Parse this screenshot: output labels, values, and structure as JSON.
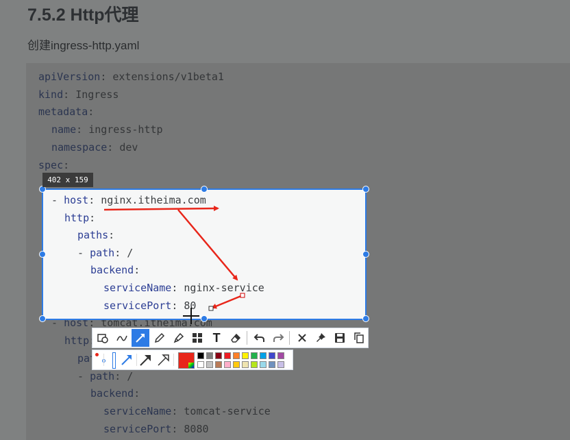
{
  "doc": {
    "heading": "7.5.2 Http代理",
    "subtext": "创建ingress-http.yaml"
  },
  "code": {
    "dim_top": [
      {
        "key": "apiVersion",
        "value": "extensions/v1beta1"
      },
      {
        "key": "kind",
        "value": "Ingress"
      },
      {
        "key": "metadata",
        "value": ""
      },
      {
        "key": "name",
        "value": "ingress-http"
      },
      {
        "key": "namespace",
        "value": "dev"
      },
      {
        "key": "spec",
        "value": ""
      }
    ],
    "selected": [
      {
        "prefix": "- ",
        "key": "host",
        "value": "nginx.itheima.com"
      },
      {
        "prefix": "",
        "key": "http",
        "value": ""
      },
      {
        "prefix": "",
        "key": "paths",
        "value": ""
      },
      {
        "prefix": "- ",
        "key": "path",
        "value": "/"
      },
      {
        "prefix": "",
        "key": "backend",
        "value": ""
      },
      {
        "prefix": "",
        "key": "serviceName",
        "value": "nginx-service"
      },
      {
        "prefix": "",
        "key": "servicePort",
        "value": "80"
      }
    ],
    "dim_bottom": [
      {
        "prefix": "- ",
        "key": "host",
        "value": "tomcat.itheima.com"
      },
      {
        "prefix": "",
        "key": "http",
        "value": ""
      },
      {
        "prefix": "",
        "key": "paths",
        "value": ""
      },
      {
        "prefix": "- ",
        "key": "path",
        "value": "/"
      },
      {
        "prefix": "",
        "key": "backend",
        "value": ""
      },
      {
        "prefix": "",
        "key": "serviceName",
        "value": "tomcat-service"
      },
      {
        "prefix": "",
        "key": "servicePort",
        "value": "8080"
      }
    ]
  },
  "capture": {
    "size_label": "402 x 159",
    "accent": "#2d7be5",
    "annotation_color": "#e8261a"
  },
  "toolbar": {
    "tools": [
      "rectangle-ellipse-tool-icon",
      "curve-tool-icon",
      "arrow-tool-icon",
      "pencil-tool-icon",
      "highlighter-tool-icon",
      "mosaic-tool-icon",
      "text-tool-icon",
      "eraser-tool-icon",
      "undo-icon",
      "redo-icon",
      "close-icon",
      "pin-icon",
      "save-icon",
      "copy-icon"
    ],
    "active_tool": "arrow-tool-icon",
    "text_tool_glyph": "T"
  },
  "palette": {
    "current": "#e8261a",
    "colors_row1": [
      "#000000",
      "#7f7f7f",
      "#880015",
      "#ed1c24",
      "#ff7f27",
      "#fff200",
      "#22b14c",
      "#00a2e8",
      "#3f48cc",
      "#a349a4"
    ],
    "colors_row2": [
      "#ffffff",
      "#c3c3c3",
      "#b97a57",
      "#ffaec9",
      "#ffc90e",
      "#efe4b0",
      "#b5e61d",
      "#99d9ea",
      "#7092be",
      "#c8bfe7"
    ]
  }
}
